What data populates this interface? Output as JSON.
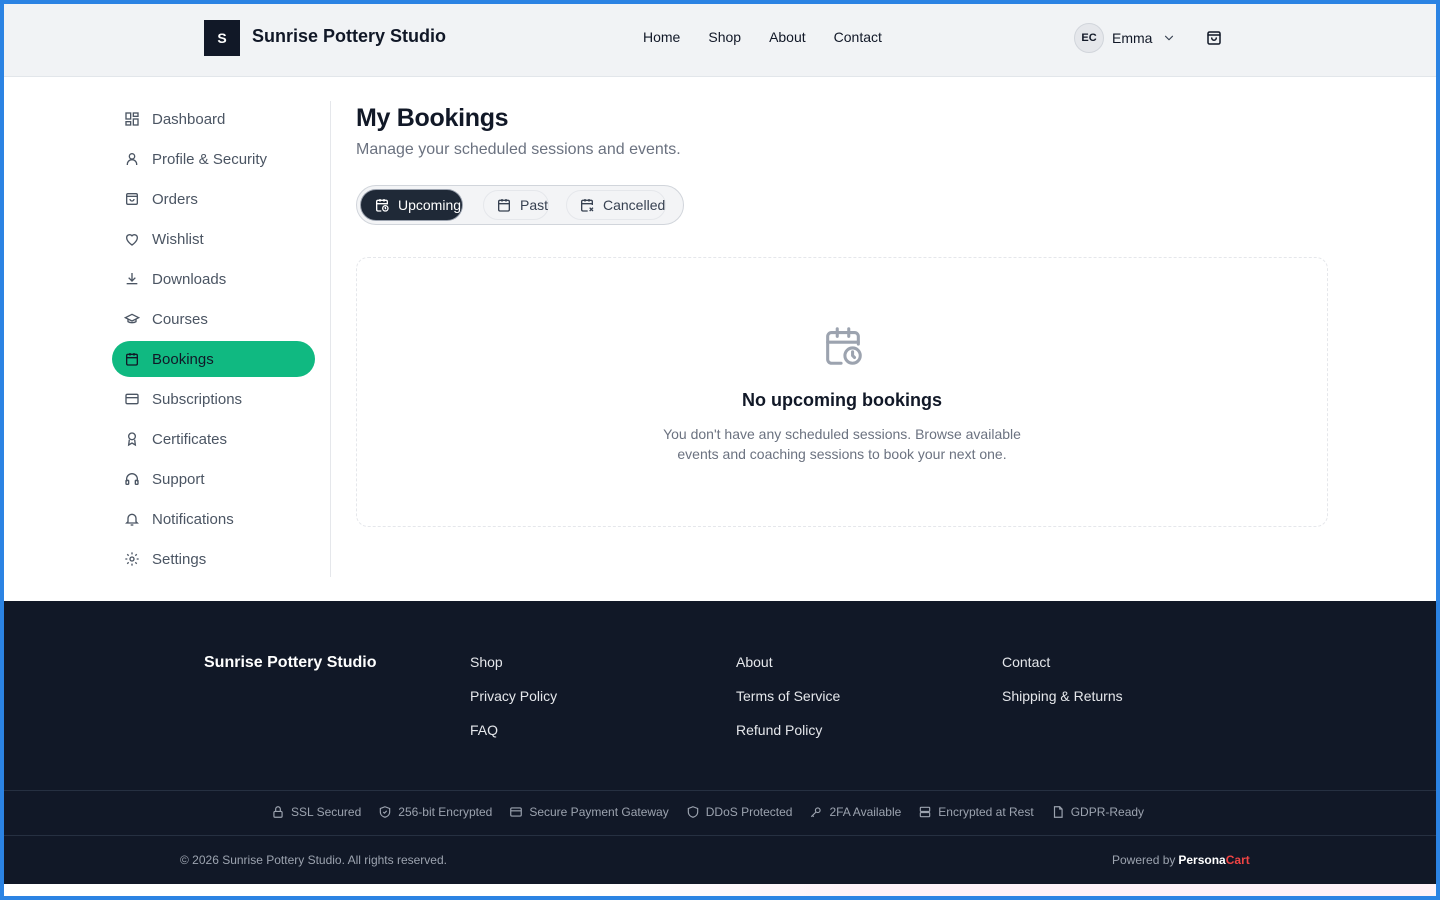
{
  "header": {
    "logo_letter": "S",
    "brand": "Sunrise Pottery Studio",
    "nav": [
      "Home",
      "Shop",
      "About",
      "Contact"
    ],
    "user_initials": "EC",
    "user_name": "Emma",
    "icons": {
      "user_menu": "chevron-down-icon",
      "cart": "shopping-bag-icon"
    }
  },
  "sidebar": {
    "items": [
      {
        "label": "Dashboard",
        "icon": "dashboard-icon"
      },
      {
        "label": "Profile & Security",
        "icon": "user-icon"
      },
      {
        "label": "Orders",
        "icon": "bag-icon"
      },
      {
        "label": "Wishlist",
        "icon": "heart-icon"
      },
      {
        "label": "Downloads",
        "icon": "download-icon"
      },
      {
        "label": "Courses",
        "icon": "graduation-cap-icon"
      },
      {
        "label": "Bookings",
        "icon": "calendar-icon",
        "active": true
      },
      {
        "label": "Subscriptions",
        "icon": "credit-card-icon"
      },
      {
        "label": "Certificates",
        "icon": "award-icon"
      },
      {
        "label": "Support",
        "icon": "headphones-icon"
      },
      {
        "label": "Notifications",
        "icon": "bell-icon"
      },
      {
        "label": "Settings",
        "icon": "gear-icon"
      }
    ],
    "active_color": "#10b981"
  },
  "main": {
    "title": "My Bookings",
    "subtitle": "Manage your scheduled sessions and events.",
    "tabs": [
      {
        "label": "Upcoming",
        "icon": "calendar-clock-icon",
        "active": true
      },
      {
        "label": "Past",
        "icon": "calendar-icon"
      },
      {
        "label": "Cancelled",
        "icon": "calendar-x-icon"
      }
    ],
    "empty": {
      "icon": "calendar-clock-icon",
      "title": "No upcoming bookings",
      "description": "You don't have any scheduled sessions. Browse available events and coaching sessions to book your next one."
    }
  },
  "footer": {
    "brand": "Sunrise Pottery Studio",
    "links": [
      "Shop",
      "About",
      "Contact",
      "Privacy Policy",
      "Terms of Service",
      "Shipping & Returns",
      "FAQ",
      "Refund Policy"
    ],
    "badges": [
      {
        "label": "SSL Secured",
        "icon": "lock-icon"
      },
      {
        "label": "256-bit Encrypted",
        "icon": "shield-check-icon"
      },
      {
        "label": "Secure Payment Gateway",
        "icon": "credit-card-icon"
      },
      {
        "label": "DDoS Protected",
        "icon": "shield-icon"
      },
      {
        "label": "2FA Available",
        "icon": "key-icon"
      },
      {
        "label": "Encrypted at Rest",
        "icon": "server-icon"
      },
      {
        "label": "GDPR-Ready",
        "icon": "document-icon"
      }
    ],
    "copyright": "© 2026 Sunrise Pottery Studio. All rights reserved.",
    "powered_by": "Powered by",
    "powered_brand_1": "Persona",
    "powered_brand_2": "Cart",
    "background": "#111827"
  }
}
